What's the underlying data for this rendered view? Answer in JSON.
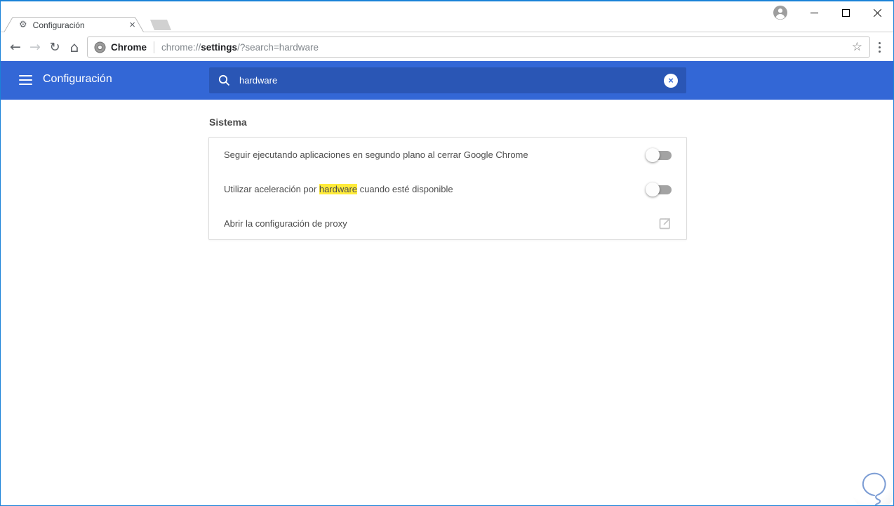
{
  "colors": {
    "window_border": "#1a82d8",
    "header_blue": "#3367d6",
    "search_box_blue": "#2a56b5",
    "highlight_yellow": "#ffeb3b",
    "toggle_track_gray": "#a3a3a3"
  },
  "icons": {
    "tab_gear": "⚙",
    "tab_close": "×",
    "back": "←",
    "forward": "→",
    "reload": "↻",
    "home": "⌂",
    "bookmark_star": "☆",
    "clear_search": "×"
  },
  "titlebar": {
    "tab_title": "Configuración"
  },
  "omnibox": {
    "site_label": "Chrome",
    "url_prefix": "chrome://",
    "url_emphasis": "settings",
    "url_suffix": "/?search=hardware"
  },
  "settings_header": {
    "title": "Configuración",
    "search_value": "hardware"
  },
  "content": {
    "section_title": "Sistema",
    "rows": [
      {
        "label": "Seguir ejecutando aplicaciones en segundo plano al cerrar Google Chrome",
        "control": "toggle",
        "state": "off"
      },
      {
        "label_pre": "Utilizar aceleración por ",
        "label_highlight": "hardware",
        "label_post": " cuando esté disponible",
        "control": "toggle",
        "state": "off"
      },
      {
        "label": "Abrir la configuración de proxy",
        "control": "external-link"
      }
    ]
  }
}
